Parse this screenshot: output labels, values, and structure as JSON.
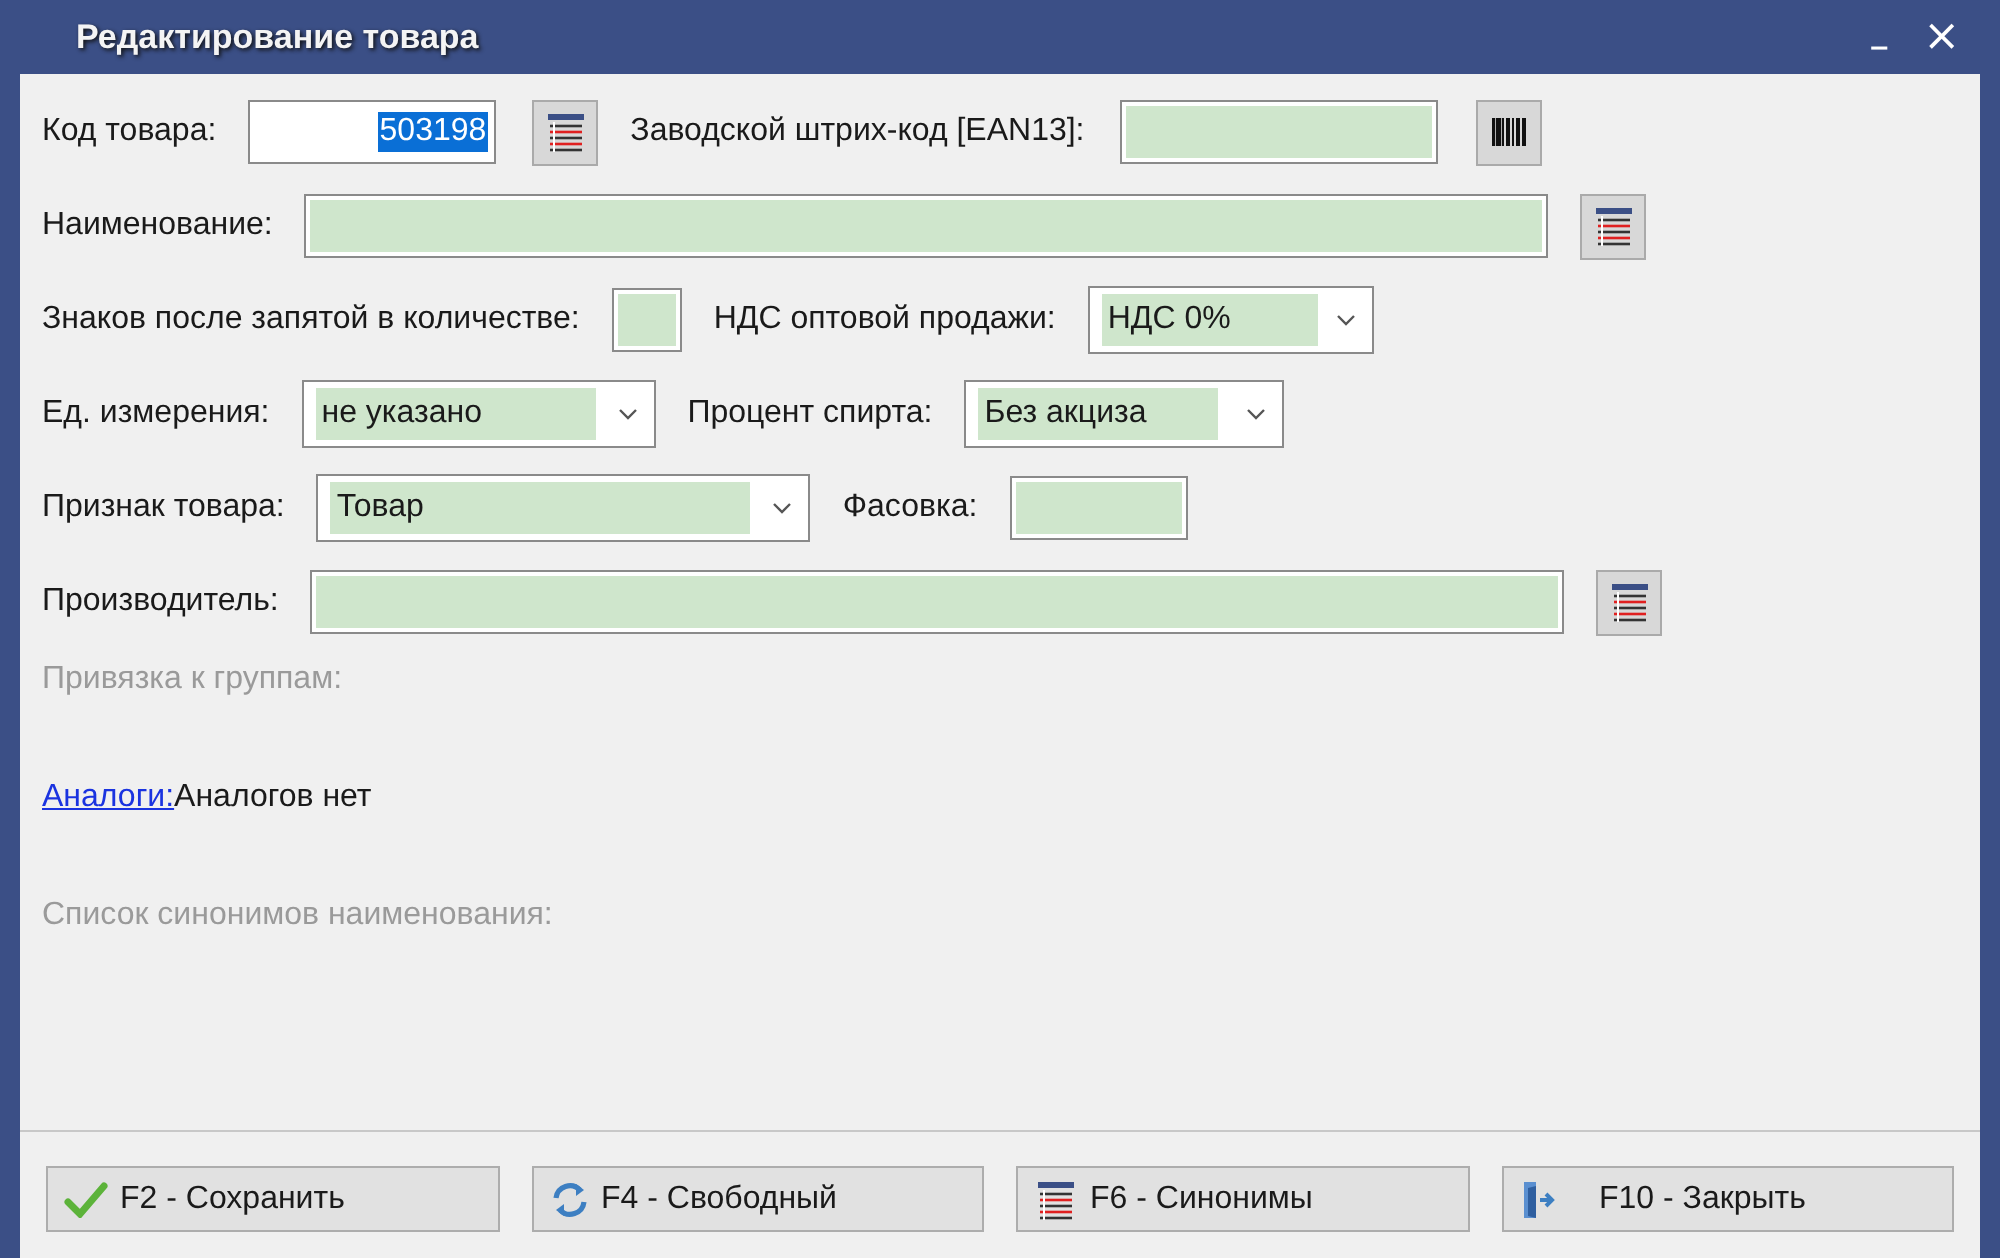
{
  "window": {
    "title": "Редактирование товара",
    "controls": [
      {
        "kind": "minimize",
        "label": "_"
      },
      {
        "kind": "close",
        "label": "×"
      }
    ]
  },
  "rows": [
    [
      {
        "kind": "label",
        "text": "Код товара:"
      },
      {
        "kind": "input",
        "value": "503198",
        "filled": false,
        "text_selected": true
      },
      {
        "kind": "list-button"
      },
      {
        "kind": "label",
        "text": "Заводской штрих-код [EAN13]:"
      },
      {
        "kind": "input",
        "filled": true
      },
      {
        "kind": "barcode-button"
      }
    ],
    [
      {
        "kind": "label",
        "text": "Наименование:"
      },
      {
        "kind": "input",
        "filled": true
      },
      {
        "kind": "list-button"
      }
    ],
    [
      {
        "kind": "label",
        "text": "Знаков после запятой в количестве:"
      },
      {
        "kind": "input",
        "filled": true
      },
      {
        "kind": "label",
        "text": "НДС оптовой продажи:"
      },
      {
        "kind": "select",
        "value": "НДС 0%"
      }
    ],
    [
      {
        "kind": "label",
        "text": "Ед. измерения:"
      },
      {
        "kind": "select",
        "value": "не указано"
      },
      {
        "kind": "label",
        "text": "Процент спирта:"
      },
      {
        "kind": "select",
        "value": "Без акциза"
      }
    ],
    [
      {
        "kind": "label",
        "text": "Признак товара:"
      },
      {
        "kind": "select",
        "value": "Товар"
      },
      {
        "kind": "label",
        "text": "Фасовка:"
      },
      {
        "kind": "input",
        "filled": true
      }
    ],
    [
      {
        "kind": "label",
        "text": "Производитель:"
      },
      {
        "kind": "input",
        "filled": true
      },
      {
        "kind": "list-button"
      }
    ]
  ],
  "sections": [
    {
      "kind": "muted",
      "text": "Привязка к группам:"
    },
    {
      "kind": "link-line",
      "link": "Аналоги:",
      "text": "Аналогов нет"
    },
    {
      "kind": "muted",
      "text": "Список синонимов наименования:"
    }
  ],
  "buttons": [
    {
      "kind": "save",
      "label": "F2 - Сохранить"
    },
    {
      "kind": "free",
      "label": "F4 - Свободный"
    },
    {
      "kind": "synonyms",
      "label": "F6 - Синонимы"
    },
    {
      "kind": "close",
      "label": "F10 - Закрыть"
    }
  ]
}
